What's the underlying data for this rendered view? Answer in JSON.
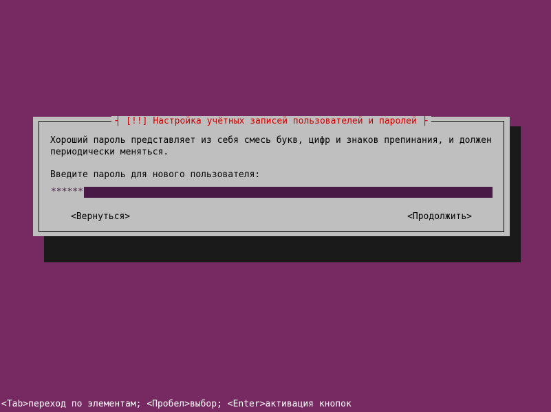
{
  "dialog": {
    "title_prefix": "[!!]",
    "title": "Настройка учётных записей пользователей и паролей",
    "description": "Хороший пароль представляет из себя смесь букв, цифр и знаков препинания, и должен периодически меняться.",
    "prompt": "Введите пароль для нового пользователя:",
    "password_mask": "******",
    "back_label": "<Вернуться>",
    "continue_label": "<Продолжить>"
  },
  "footer": {
    "tab_key": "<Tab>",
    "tab_text": "переход по элементам; ",
    "space_key": "<Пробел>",
    "space_text": "выбор; ",
    "enter_key": "<Enter>",
    "enter_text": "активация кнопок"
  }
}
